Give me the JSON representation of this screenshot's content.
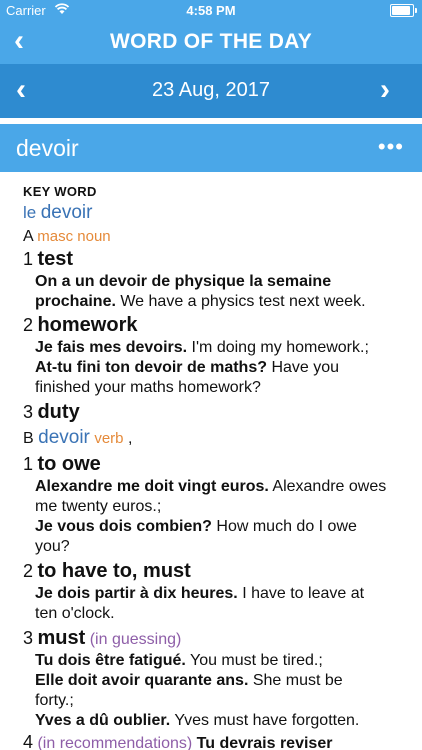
{
  "status": {
    "carrier": "Carrier",
    "time": "4:58 PM"
  },
  "nav": {
    "title": "WORD OF THE DAY"
  },
  "date_bar": {
    "date": "23 Aug, 2017"
  },
  "word": {
    "headword": "devoir"
  },
  "entry": {
    "key_word_label": "KEY WORD",
    "article": "le",
    "lemma": "devoir",
    "sectionA": {
      "letter": "A",
      "pos": "masc noun"
    },
    "a1": {
      "num": "1",
      "word": "test",
      "ex1_fr_l1": "On a un devoir de physique la semaine",
      "ex1_fr_l2": "prochaine.",
      "ex1_en": "We have a physics test next week."
    },
    "a2": {
      "num": "2",
      "word": "homework",
      "ex1_fr": "Je fais mes devoirs.",
      "ex1_en": "I'm doing my homework.;",
      "ex2_fr": "At-tu fini ton devoir de maths?",
      "ex2_en_l1": "Have you",
      "ex2_en_l2": "finished your maths homework?"
    },
    "a3": {
      "num": "3",
      "word": "duty"
    },
    "sectionB": {
      "letter": "B",
      "word": "devoir",
      "pos": "verb",
      "comma": ","
    },
    "b1": {
      "num": "1",
      "word": "to owe",
      "ex1_fr": "Alexandre me doit vingt euros.",
      "ex1_en_l1": "Alexandre owes",
      "ex1_en_l2": "me twenty euros.;",
      "ex2_fr": "Je vous dois combien?",
      "ex2_en_l1": "How much do I owe",
      "ex2_en_l2": "you?"
    },
    "b2": {
      "num": "2",
      "word": "to have to, must",
      "ex1_fr": "Je dois partir à dix heures.",
      "ex1_en_l1": "I have to leave at",
      "ex1_en_l2": "ten o'clock."
    },
    "b3": {
      "num": "3",
      "word": "must",
      "note": "(in guessing)",
      "ex1_fr": "Tu dois être fatigué.",
      "ex1_en": "You must be tired.;",
      "ex2_fr": "Elle doit avoir quarante ans.",
      "ex2_en_l1": "She must be",
      "ex2_en_l2": "forty.;",
      "ex3_fr": "Yves a dû oublier.",
      "ex3_en": "Yves must have forgotten."
    },
    "b4": {
      "num": "4",
      "note": "(in recommendations)",
      "fr_partial": "Tu devrais reviser"
    }
  }
}
